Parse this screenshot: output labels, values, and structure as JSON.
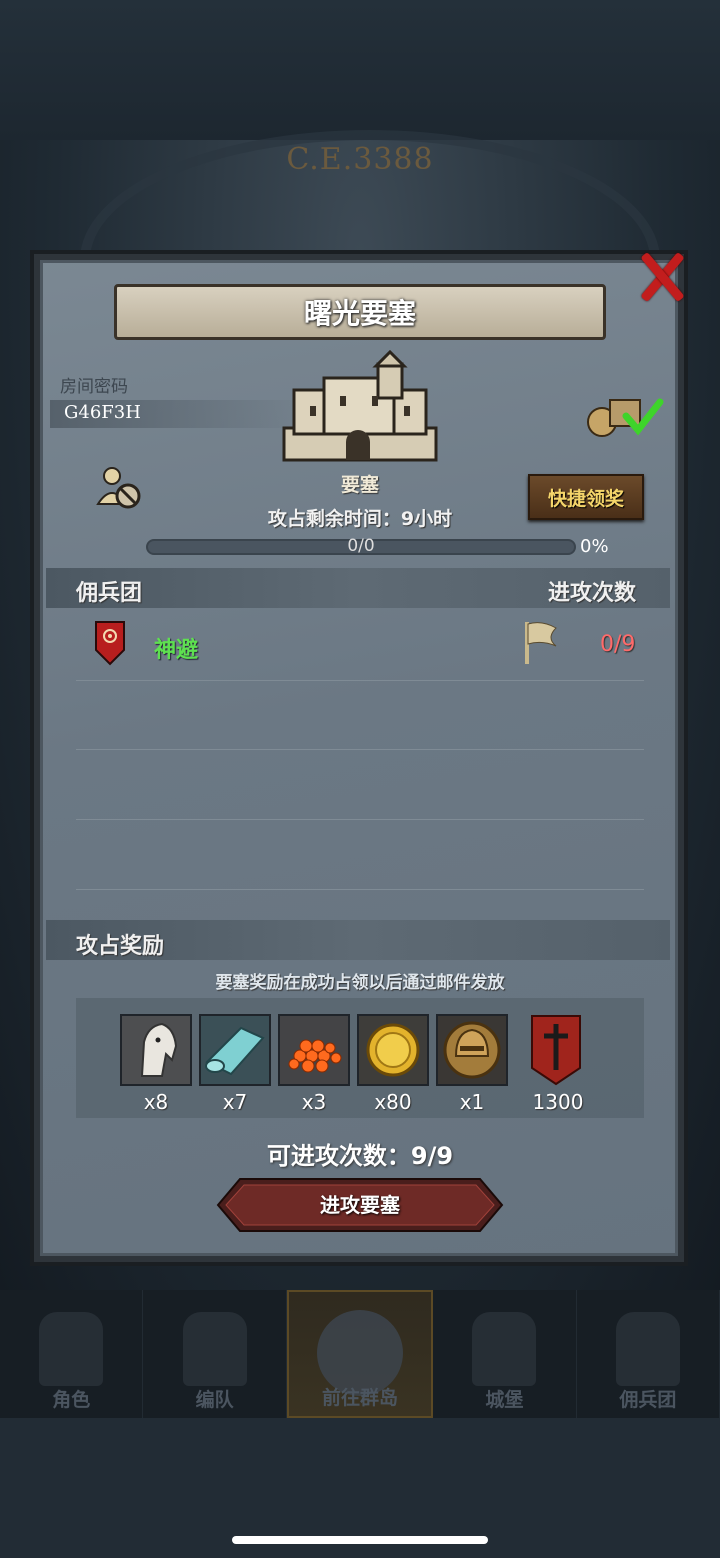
{
  "background": {
    "era_text": "C.E.3388"
  },
  "bottom_nav": [
    {
      "label": "角色"
    },
    {
      "label": "编队"
    },
    {
      "label": "前往群岛"
    },
    {
      "label": "城堡"
    },
    {
      "label": "佣兵团"
    }
  ],
  "dialog": {
    "title": "曙光要塞",
    "room_label": "房间密码",
    "room_code": "G46F3H",
    "fortress_label": "要塞",
    "quick_claim_label": "快捷领奖",
    "time_remaining": "攻占剩余时间：9小时",
    "progress": {
      "text": "0/0",
      "percent_text": "0%",
      "fraction": 0
    },
    "mercenary_header": "佣兵团",
    "attack_count_header": "进攻次数",
    "guilds": [
      {
        "name": "神避",
        "attacks": "0/9"
      }
    ],
    "rewards_header": "攻占奖励",
    "rewards_note": "要塞奖励在成功占领以后通过邮件发放",
    "rewards": [
      {
        "icon": "horse-icon",
        "qty": "x8"
      },
      {
        "icon": "cloth-icon",
        "qty": "x7"
      },
      {
        "icon": "roe-icon",
        "qty": "x3"
      },
      {
        "icon": "gold-coin-icon",
        "qty": "x80"
      },
      {
        "icon": "helmet-coin-icon",
        "qty": "x1"
      },
      {
        "icon": "sword-banner-icon",
        "qty": "1300"
      }
    ],
    "attacks_available": "可进攻次数：9/9",
    "attack_button_label": "进攻要塞"
  }
}
